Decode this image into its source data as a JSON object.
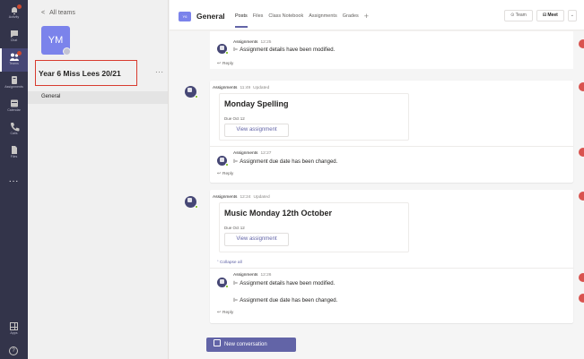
{
  "rail": {
    "items": [
      {
        "label": "Activity",
        "icon": "bell-icon"
      },
      {
        "label": "Chat",
        "icon": "chat-icon"
      },
      {
        "label": "Teams",
        "icon": "teams-icon"
      },
      {
        "label": "Assignments",
        "icon": "assignments-icon"
      },
      {
        "label": "Calendar",
        "icon": "calendar-icon"
      },
      {
        "label": "Calls",
        "icon": "phone-icon"
      },
      {
        "label": "Files",
        "icon": "files-icon"
      }
    ],
    "more": "...",
    "apps_label": "Apps",
    "help_glyph": "?"
  },
  "sidebar": {
    "back_label": "All teams",
    "avatar_initials": "YM",
    "team_name": "Year 6 Miss Lees 20/21",
    "more": "···",
    "channel": "General"
  },
  "header": {
    "channel_icon_text": "Y6",
    "title": "General",
    "tabs": [
      "Posts",
      "Files",
      "Class Notebook",
      "Assignments",
      "Grades"
    ],
    "add_tab": "+",
    "team_button": "⊙ Team",
    "meet_button": "⊡ Meet",
    "meet_dropdown": "⌄"
  },
  "feed": {
    "thread0": {
      "reply1": {
        "author": "Assignments",
        "time": "12:25",
        "text": "Assignment details have been modified."
      },
      "reply_label": "Reply"
    },
    "thread1": {
      "author": "Assignments",
      "time": "11:49",
      "status": "Updated",
      "card_title": "Monday Spelling",
      "due": "Due Oct 12",
      "button": "View assignment",
      "reply1": {
        "author": "Assignments",
        "time": "12:27",
        "text": "Assignment due date has been changed."
      },
      "reply_label": "Reply"
    },
    "thread2": {
      "author": "Assignments",
      "time": "12:24",
      "status": "Updated",
      "card_title": "Music Monday 12th October",
      "due": "Due Oct 12",
      "button": "View assignment",
      "collapse": "Collapse all",
      "reply1": {
        "author": "Assignments",
        "time": "12:26",
        "text": "Assignment details have been modified."
      },
      "reply2": {
        "text": "Assignment due date has been changed."
      },
      "reply_label": "Reply"
    },
    "new_conversation": "New conversation"
  },
  "colors": {
    "rail": "#33344a",
    "accent": "#6264a7",
    "highlight_box": "#d83b2f",
    "reaction": "#d9534f"
  }
}
